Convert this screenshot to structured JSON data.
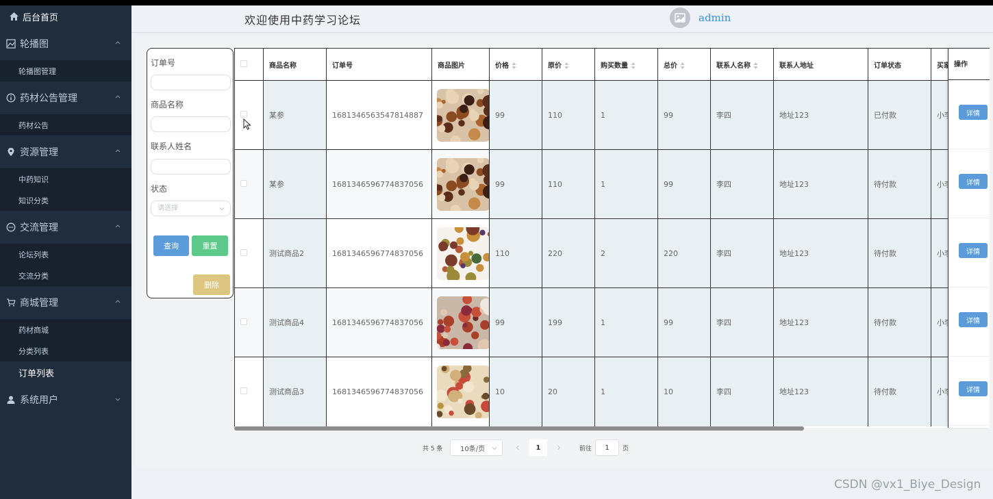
{
  "sidebar": {
    "home_label": "后台首页",
    "groups": [
      {
        "label": "轮播图",
        "icon": "picture-icon",
        "items": [
          "轮播图管理"
        ]
      },
      {
        "label": "药材公告管理",
        "icon": "info-icon",
        "items": [
          "药材公告"
        ]
      },
      {
        "label": "资源管理",
        "icon": "location-icon",
        "items": [
          "中药知识",
          "知识分类"
        ]
      },
      {
        "label": "交流管理",
        "icon": "chat-icon",
        "items": [
          "论坛列表",
          "交流分类"
        ]
      },
      {
        "label": "商城管理",
        "icon": "cart-icon",
        "items": [
          "药材商城",
          "分类列表",
          "订单列表"
        ]
      },
      {
        "label": "系统用户",
        "icon": "user-icon",
        "items": []
      }
    ],
    "active_item": "订单列表"
  },
  "header": {
    "title": "欢迎使用中药学习论坛",
    "username": "admin"
  },
  "search": {
    "order_no_label": "订单号",
    "product_name_label": "商品名称",
    "contact_name_label": "联系人姓名",
    "status_label": "状态",
    "status_placeholder": "请选择",
    "query_button": "查询",
    "reset_button": "重置",
    "delete_button": "删除"
  },
  "table": {
    "columns": [
      "商品名称",
      "订单号",
      "商品图片",
      "价格",
      "原价",
      "购买数量",
      "总价",
      "联系人名称",
      "联系人地址",
      "订单状态",
      "买家",
      "操作"
    ],
    "rows": [
      {
        "name": "某参",
        "order_no": "1681346563547814887",
        "price": "99",
        "orig_price": "110",
        "qty": "1",
        "total": "99",
        "contact": "李四",
        "address": "地址123",
        "status": "已付款",
        "buyer": "小李",
        "img": "herbs-a"
      },
      {
        "name": "某参",
        "order_no": "1681346596774837056",
        "price": "99",
        "orig_price": "110",
        "qty": "1",
        "total": "99",
        "contact": "李四",
        "address": "地址123",
        "status": "待付款",
        "buyer": "小李",
        "img": "herbs-a"
      },
      {
        "name": "测试商品2",
        "order_no": "1681346596774837056",
        "price": "110",
        "orig_price": "220",
        "qty": "2",
        "total": "220",
        "contact": "李四",
        "address": "地址123",
        "status": "待付款",
        "buyer": "小李",
        "img": "herbs-b"
      },
      {
        "name": "测试商品4",
        "order_no": "1681346596774837056",
        "price": "99",
        "orig_price": "199",
        "qty": "1",
        "total": "99",
        "contact": "李四",
        "address": "地址123",
        "status": "待付款",
        "buyer": "小李",
        "img": "herbs-c"
      },
      {
        "name": "测试商品3",
        "order_no": "1681346596774837056",
        "price": "10",
        "orig_price": "20",
        "qty": "1",
        "total": "10",
        "contact": "李四",
        "address": "地址123",
        "status": "待付款",
        "buyer": "小李",
        "img": "herbs-d"
      }
    ],
    "detail_button": "详情"
  },
  "pager": {
    "total_text": "共 5 条",
    "page_size": "10条/页",
    "current_page": "1",
    "goto_label": "前往",
    "goto_value": "1",
    "page_suffix": "页"
  },
  "watermark": "CSDN @vx1_Biye_Design",
  "colors": {
    "sidebar_bg": "#1f2d3d",
    "primary": "#5b9bd9",
    "reset": "#5cc98a",
    "delete": "#dcc680",
    "username": "#3a8ee6"
  }
}
